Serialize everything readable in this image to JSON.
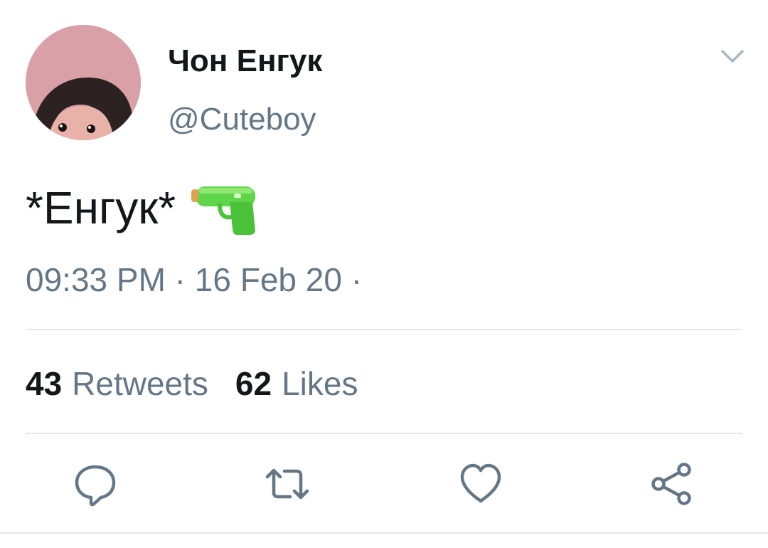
{
  "user": {
    "display_name": "Чон Енгук",
    "handle": "@Cuteboy"
  },
  "tweet": {
    "text": "*Енгук*",
    "emoji": "water-pistol-emoji",
    "time": "09:33 PM",
    "date": "16 Feb 20",
    "meta_line": "09:33 PM · 16 Feb 20 ·"
  },
  "stats": {
    "retweets_count": "43",
    "retweets_label": "Retweets",
    "likes_count": "62",
    "likes_label": "Likes"
  },
  "icons": {
    "menu": "chevron-down-icon",
    "reply": "reply-bubble-icon",
    "retweet": "retweet-icon",
    "like": "heart-icon",
    "share": "share-icon"
  },
  "colors": {
    "text_primary": "#14171a",
    "text_secondary": "#657786",
    "divider": "#e1e8ed",
    "icon": "#657786",
    "emoji_green": "#5fd54a"
  }
}
